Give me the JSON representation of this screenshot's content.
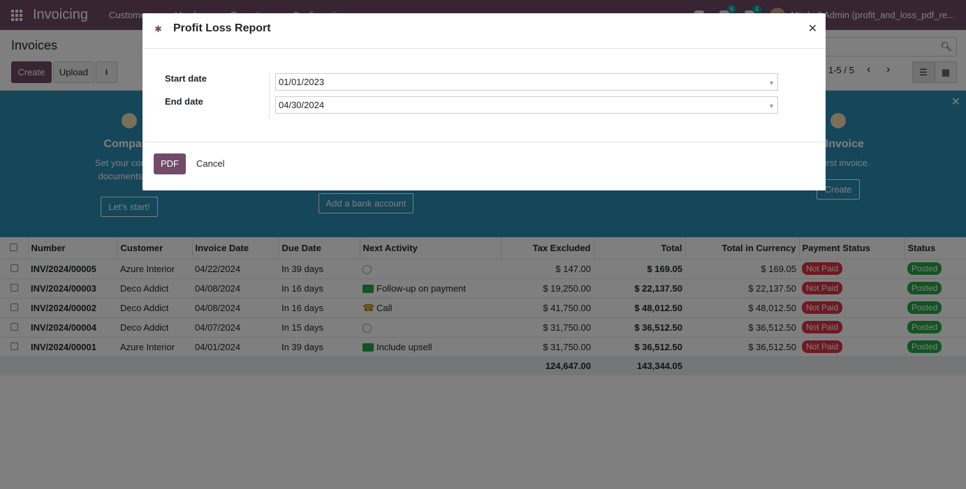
{
  "navbar": {
    "app_name": "Invoicing",
    "menu": [
      "Customers",
      "Vendors",
      "Reporting",
      "Configuration"
    ],
    "messages_badge": "5",
    "activities_badge": "4",
    "user": "Mitchell Admin (profit_and_loss_pdf_re..."
  },
  "control_panel": {
    "title": "Invoices",
    "create_label": "Create",
    "upload_label": "Upload",
    "pager": "1-5 / 5"
  },
  "onboarding": {
    "step1": {
      "title": "Company",
      "desc_line1": "Set your compan",
      "desc_line2": "documents hea",
      "button": "Let's start!"
    },
    "step2": {
      "button": "Add a bank account"
    },
    "step3": {
      "title": "te Invoice",
      "desc": "our first invoice.",
      "button": "Create"
    }
  },
  "table": {
    "headers": [
      "Number",
      "Customer",
      "Invoice Date",
      "Due Date",
      "Next Activity",
      "Tax Excluded",
      "Total",
      "Total in Currency",
      "Payment Status",
      "Status"
    ],
    "rows": [
      {
        "number": "INV/2024/00005",
        "customer": "Azure Interior",
        "invoice_date": "04/22/2024",
        "due": "In 39 days",
        "activity_icon": "clock-icon",
        "activity": "",
        "tax_excl": "$ 147.00",
        "total": "$ 169.05",
        "total_cur": "$ 169.05",
        "payment": "Not Paid",
        "status": "Posted"
      },
      {
        "number": "INV/2024/00003",
        "customer": "Deco Addict",
        "invoice_date": "04/08/2024",
        "due": "In 16 days",
        "activity_icon": "email-icon",
        "activity": "Follow-up on payment",
        "tax_excl": "$ 19,250.00",
        "total": "$ 22,137.50",
        "total_cur": "$ 22,137.50",
        "payment": "Not Paid",
        "status": "Posted"
      },
      {
        "number": "INV/2024/00002",
        "customer": "Deco Addict",
        "invoice_date": "04/08/2024",
        "due": "In 16 days",
        "activity_icon": "phone-icon",
        "activity": "Call",
        "tax_excl": "$ 41,750.00",
        "total": "$ 48,012.50",
        "total_cur": "$ 48,012.50",
        "payment": "Not Paid",
        "status": "Posted"
      },
      {
        "number": "INV/2024/00004",
        "customer": "Deco Addict",
        "invoice_date": "04/07/2024",
        "due": "In 15 days",
        "activity_icon": "clock-icon",
        "activity": "",
        "tax_excl": "$ 31,750.00",
        "total": "$ 36,512.50",
        "total_cur": "$ 36,512.50",
        "payment": "Not Paid",
        "status": "Posted"
      },
      {
        "number": "INV/2024/00001",
        "customer": "Azure Interior",
        "invoice_date": "04/01/2024",
        "due": "In 39 days",
        "activity_icon": "email-icon",
        "activity": "Include upsell",
        "tax_excl": "$ 31,750.00",
        "total": "$ 36,512.50",
        "total_cur": "$ 36,512.50",
        "payment": "Not Paid",
        "status": "Posted"
      }
    ],
    "totals": {
      "tax_excl": "124,647.00",
      "total": "143,344.05"
    }
  },
  "modal": {
    "title": "Profit Loss Report",
    "start_label": "Start date",
    "start_value": "01/01/2023",
    "end_label": "End date",
    "end_value": "04/30/2024",
    "pdf_label": "PDF",
    "cancel_label": "Cancel"
  },
  "colors": {
    "brand": "#714B67",
    "banner": "#2b8cb4",
    "not_paid": "#dc3545",
    "posted": "#28a745"
  }
}
